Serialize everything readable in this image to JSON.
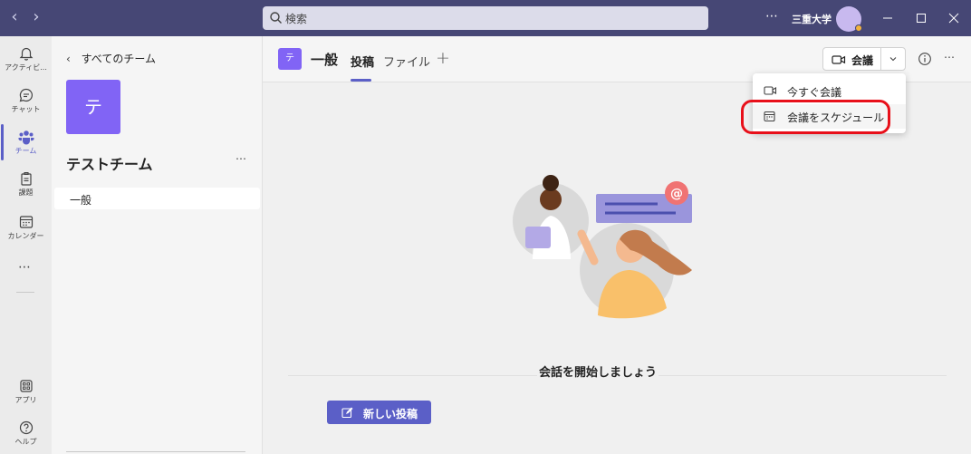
{
  "titlebar": {
    "back_icon": "chevron-left-icon",
    "forward_icon": "chevron-right-icon",
    "search_placeholder": "検索",
    "more": "⋯",
    "org_name": "三重大学",
    "minimize_icon": "minimize-icon",
    "maximize_icon": "maximize-icon",
    "close_icon": "close-icon"
  },
  "rail": {
    "items": [
      {
        "label": "アクティビ...",
        "icon": "bell-icon"
      },
      {
        "label": "チャット",
        "icon": "chat-icon"
      },
      {
        "label": "チーム",
        "icon": "teams-icon",
        "active": true
      },
      {
        "label": "課題",
        "icon": "assignments-icon"
      },
      {
        "label": "カレンダー",
        "icon": "calendar-icon"
      }
    ],
    "more": "⋯",
    "bottom": [
      {
        "label": "アプリ",
        "icon": "apps-icon"
      },
      {
        "label": "ヘルプ",
        "icon": "help-icon"
      }
    ]
  },
  "teampane": {
    "back_label": "すべてのチーム",
    "team_initial": "テ",
    "team_name": "テストチーム",
    "more": "⋯",
    "channels": [
      {
        "label": "一般",
        "selected": true
      }
    ]
  },
  "main": {
    "channel_initial": "テ",
    "channel_title": "一般",
    "tabs": [
      {
        "label": "投稿",
        "active": true
      },
      {
        "label": "ファイル",
        "active": false
      }
    ],
    "add_tab": "+",
    "meet_label": "会議",
    "more": "⋯",
    "menu": [
      {
        "label": "今すぐ会議",
        "icon": "video-camera-icon"
      },
      {
        "label": "会議をスケジュール",
        "icon": "calendar-icon",
        "highlighted": true
      }
    ],
    "empty_title": "会話を開始しましょう",
    "new_post_label": "新しい投稿"
  },
  "colors": {
    "titlebar": "#464775",
    "accent": "#5b5fc7",
    "team_tile": "#8164f5",
    "highlight_ring": "#e8101a"
  }
}
